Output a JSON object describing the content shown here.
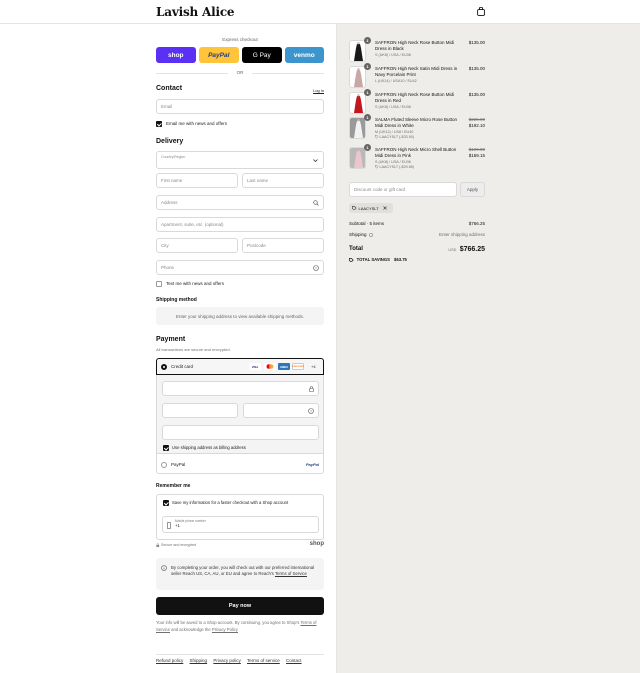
{
  "header": {
    "brand": "Lavish Alice",
    "cart_icon": "shopping-bag-icon"
  },
  "express": {
    "label": "Express checkout",
    "buttons": [
      {
        "label": "shop",
        "color": "#5a31f4"
      },
      {
        "label": "PayPal",
        "color": "#ffc439"
      },
      {
        "label": "G Pay",
        "color": "#000000"
      },
      {
        "label": "venmo",
        "color": "#3d95ce"
      }
    ],
    "or": "OR"
  },
  "contact": {
    "title": "Contact",
    "login_link": "Log in",
    "email_placeholder": "Email",
    "news_checkbox": "Email me with news and offers",
    "news_checked": true
  },
  "delivery": {
    "title": "Delivery",
    "country_label": "Country/Region",
    "first_name": "First name",
    "last_name": "Last name",
    "address": "Address",
    "apartment": "Apartment, suite, etc. (optional)",
    "city": "City",
    "postcode": "Postcode",
    "phone": "Phone",
    "text_checkbox": "Text me with news and offers",
    "text_checked": false
  },
  "shipping": {
    "title": "Shipping method",
    "note": "Enter your shipping address to view available shipping methods."
  },
  "payment": {
    "title": "Payment",
    "subtitle": "All transactions are secure and encrypted.",
    "credit_card_label": "Credit card",
    "card_logos": [
      {
        "label": "VISA",
        "bg": "#ffffff",
        "fg": "#1a1f71"
      },
      {
        "label": "MC",
        "bg": "#ffffff",
        "fg": "#eb001b"
      },
      {
        "label": "AMEX",
        "bg": "#2e77bc",
        "fg": "#ffffff"
      },
      {
        "label": "DISCOVER",
        "bg": "#ffffff",
        "fg": "#f47216"
      }
    ],
    "more_cards": "+4",
    "billing_checkbox": "Use shipping address as billing address",
    "billing_checked": true,
    "paypal_label": "PayPal",
    "paypal_logo": "PayPal"
  },
  "remember": {
    "title": "Remember me",
    "save_checkbox": "Save my information for a faster checkout with a Shop account",
    "save_checked": true,
    "mobile_label": "Mobile phone number",
    "mobile_value": "+1",
    "secure_text": "Secure and encrypted",
    "shop_logo": "shop"
  },
  "notice": {
    "text": "By completing your order, you will check out with our preferred international seller Reach US, CA, AU, or EU and agree to Reach's",
    "link": "Terms of Service"
  },
  "paynow": "Pay now",
  "disclaimer": {
    "text": "Your info will be saved to a Shop account. By continuing, you agree to Shop's",
    "terms": "Terms of Service",
    "and": "and acknowledge the",
    "privacy": "Privacy Policy"
  },
  "footer": [
    "Refund policy",
    "Shipping",
    "Privacy policy",
    "Terms of service",
    "Contact"
  ],
  "order": {
    "items": [
      {
        "qty": "1",
        "name": "SAFFRON High Neck Rose Button Midi Dress in Black",
        "variant": "S (UK8) / USA / EU36",
        "price": "$135.00",
        "original": "",
        "discount": "",
        "dress_color": "#1a1a1a"
      },
      {
        "qty": "1",
        "name": "SAFFRON High Neck Satin Midi Dress in Navy Porcelain Print",
        "variant": "L (UK14) / USA10 / EU42",
        "price": "$135.00",
        "original": "",
        "discount": "",
        "dress_color": "#c9a7a4"
      },
      {
        "qty": "1",
        "name": "SAFFRON High Neck Rose Button Midi Dress in Red",
        "variant": "S (UK8) / USA / EU36",
        "price": "$135.00",
        "original": "",
        "discount": "",
        "dress_color": "#c4161c"
      },
      {
        "qty": "1",
        "name": "SALMA Fluted Sleeve Micro Rose Button Midi Dress in White",
        "variant": "M (UK12) / US8 / EU40",
        "price": "$192.10",
        "original": "$226.00",
        "discount": "LAACYSLT (-$33.90)",
        "dress_color": "#e8e8e8"
      },
      {
        "qty": "1",
        "name": "SAFFRON High Neck Micro Shell Button Midi Dress in Pink",
        "variant": "S (UK8) / USA / EU36",
        "price": "$169.15",
        "original": "$199.00",
        "discount": "LAACYSLT (-$29.85)",
        "dress_color": "#ecc6cf"
      }
    ],
    "discount_placeholder": "Discount code or gift card",
    "apply": "Apply",
    "applied_code": "LAACYSLT",
    "subtotal_label": "Subtotal · 5 items",
    "subtotal_value": "$766.25",
    "shipping_label": "Shipping",
    "shipping_value": "Enter shipping address",
    "total_label": "Total",
    "currency": "USD",
    "total_value": "$766.25",
    "savings_label": "TOTAL SAVINGS",
    "savings_value": "$63.75"
  }
}
